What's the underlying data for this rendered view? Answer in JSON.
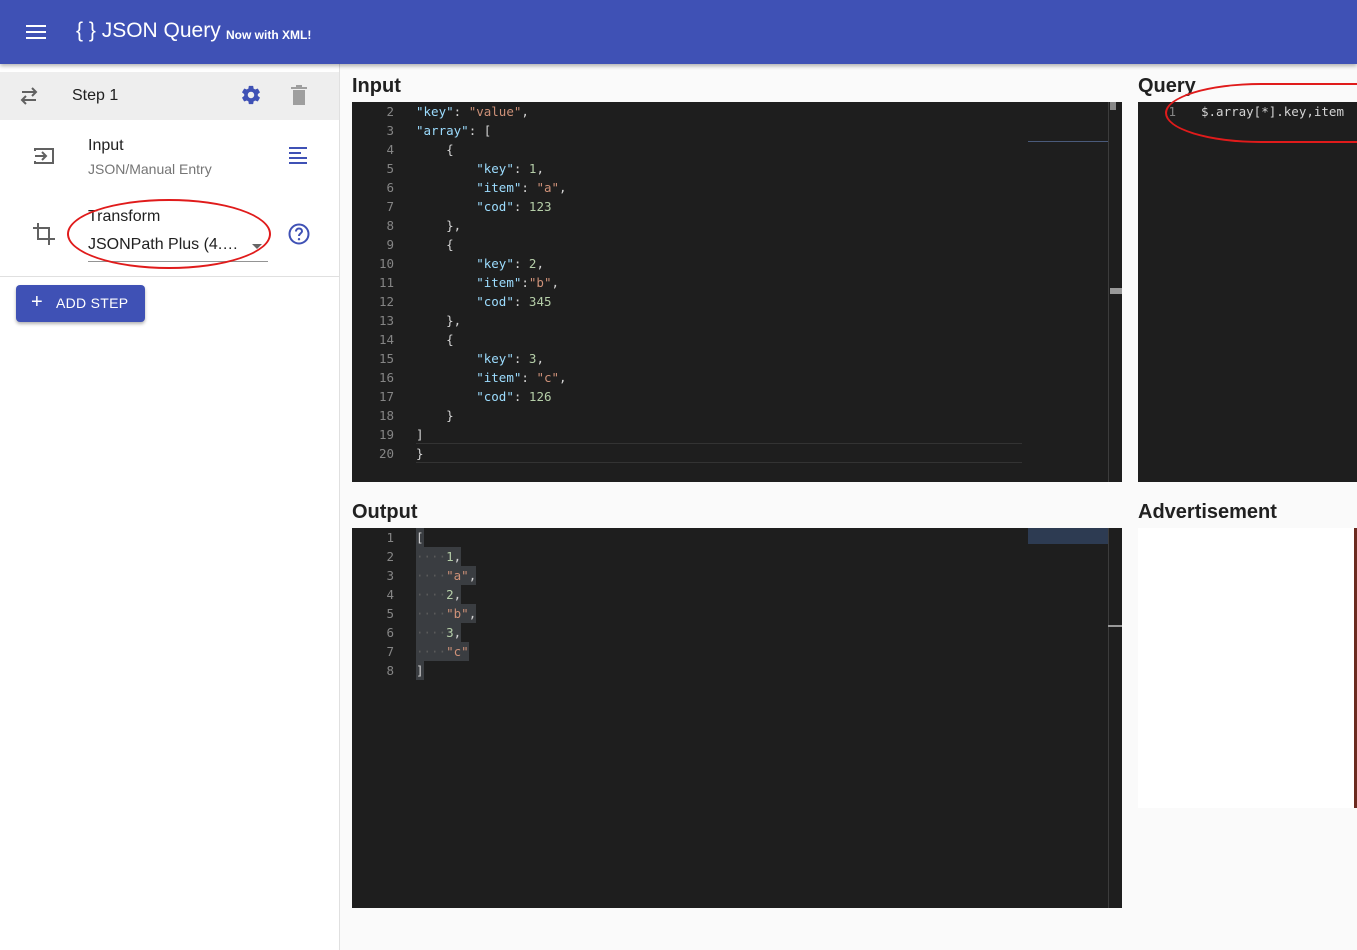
{
  "header": {
    "title": "{ } JSON Query",
    "subtitle": "Now with XML!",
    "menu_icon": "menu-icon"
  },
  "sidebar": {
    "step_title": "Step 1",
    "input_item": {
      "title": "Input",
      "subtitle": "JSON/Manual Entry"
    },
    "transform": {
      "label": "Transform",
      "selected": "JSONPath Plus (4.…"
    },
    "add_step_label": "ADD STEP"
  },
  "sections": {
    "input": "Input",
    "query": "Query",
    "output": "Output",
    "ad": "Advertisement"
  },
  "input_editor": {
    "lines": [
      {
        "no": "2",
        "code": "\"key\": \"value\","
      },
      {
        "no": "3",
        "code": "\"array\": ["
      },
      {
        "no": "4",
        "code": "    {"
      },
      {
        "no": "5",
        "code": "        \"key\": 1,"
      },
      {
        "no": "6",
        "code": "        \"item\": \"a\","
      },
      {
        "no": "7",
        "code": "        \"cod\": 123"
      },
      {
        "no": "8",
        "code": "    },"
      },
      {
        "no": "9",
        "code": "    {"
      },
      {
        "no": "10",
        "code": "        \"key\": 2,"
      },
      {
        "no": "11",
        "code": "        \"item\":\"b\","
      },
      {
        "no": "12",
        "code": "        \"cod\": 345"
      },
      {
        "no": "13",
        "code": "    },"
      },
      {
        "no": "14",
        "code": "    {"
      },
      {
        "no": "15",
        "code": "        \"key\": 3,"
      },
      {
        "no": "16",
        "code": "        \"item\": \"c\","
      },
      {
        "no": "17",
        "code": "        \"cod\": 126"
      },
      {
        "no": "18",
        "code": "    }"
      },
      {
        "no": "19",
        "code": "]"
      },
      {
        "no": "20",
        "code": "}"
      }
    ]
  },
  "query_editor": {
    "lines": [
      {
        "no": "1",
        "code": "$.array[*].key,item"
      }
    ]
  },
  "output_editor": {
    "lines": [
      {
        "no": "1",
        "code": "["
      },
      {
        "no": "2",
        "code": "    1,"
      },
      {
        "no": "3",
        "code": "    \"a\","
      },
      {
        "no": "4",
        "code": "    2,"
      },
      {
        "no": "5",
        "code": "    \"b\","
      },
      {
        "no": "6",
        "code": "    3,"
      },
      {
        "no": "7",
        "code": "    \"c\""
      },
      {
        "no": "8",
        "code": "]"
      }
    ]
  },
  "colors": {
    "primary": "#3f51b5",
    "editor_bg": "#1e1e1e",
    "annotation": "#e01b1b"
  }
}
